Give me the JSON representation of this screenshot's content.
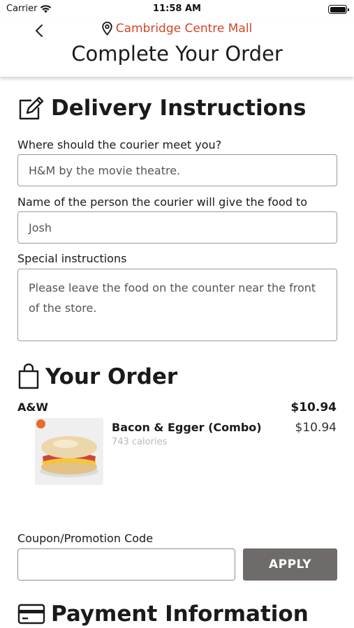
{
  "status_bar": {
    "carrier": "Carrier",
    "time": "11:58 AM"
  },
  "header": {
    "location": "Cambridge Centre Mall",
    "title": "Complete Your Order"
  },
  "delivery": {
    "title": "Delivery Instructions",
    "meet_label": "Where should the courier meet you?",
    "meet_value": "H&M by the movie theatre.",
    "name_label": "Name of the person the courier will give the food to",
    "name_value": "Josh",
    "special_label": "Special instructions",
    "special_value": "Please leave the food on the counter near the front of the store."
  },
  "order": {
    "title": "Your Order",
    "vendor": "A&W",
    "vendor_total": "$10.94",
    "items": [
      {
        "name": "Bacon & Egger (Combo)",
        "calories": "743 calories",
        "price": "$10.94"
      }
    ]
  },
  "coupon": {
    "label": "Coupon/Promotion Code",
    "value": "",
    "button": "APPLY"
  },
  "payment": {
    "title": "Payment Information"
  },
  "colors": {
    "accent": "#d2462a",
    "button_bg": "#6e6b6a"
  }
}
